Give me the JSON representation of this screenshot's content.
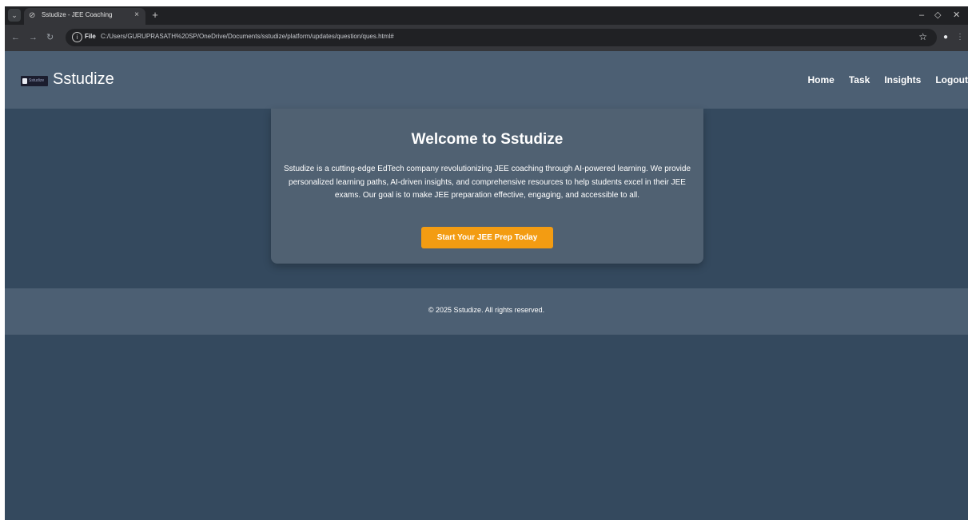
{
  "browser": {
    "tab_title": "Sstudize - JEE Coaching",
    "tab_close": "×",
    "new_tab": "+",
    "file_label": "File",
    "url": "C:/Users/GURUPRASATH%20SP/OneDrive/Documents/sstudize/platform/updates/question/ques.html#",
    "icons": [
      "tab-search-icon",
      "globe-icon",
      "close-icon",
      "plus-icon",
      "minimize-icon",
      "restore-icon",
      "close-window-icon",
      "back-icon",
      "forward-icon",
      "reload-icon",
      "info-icon",
      "star-icon",
      "profile-icon",
      "more-icon"
    ]
  },
  "site": {
    "logo_text": "Sstudize",
    "brand": "Sstudize",
    "nav": [
      "Home",
      "Task",
      "Insights",
      "Logout"
    ]
  },
  "hero": {
    "title": "Welcome to Sstudize",
    "text": "Sstudize is a cutting-edge EdTech company revolutionizing JEE coaching through AI-powered learning. We provide personalized learning paths, AI-driven insights, and comprehensive resources to help students excel in their JEE exams. Our goal is to make JEE preparation effective, engaging, and accessible to all.",
    "cta": "Start Your JEE Prep Today"
  },
  "footer": {
    "text": "© 2025 Sstudize. All rights reserved."
  },
  "colors": {
    "page_bg": "#34495e",
    "header_bg": "#4c5f73",
    "card_bg": "#506172",
    "cta_bg": "#f39c12"
  }
}
